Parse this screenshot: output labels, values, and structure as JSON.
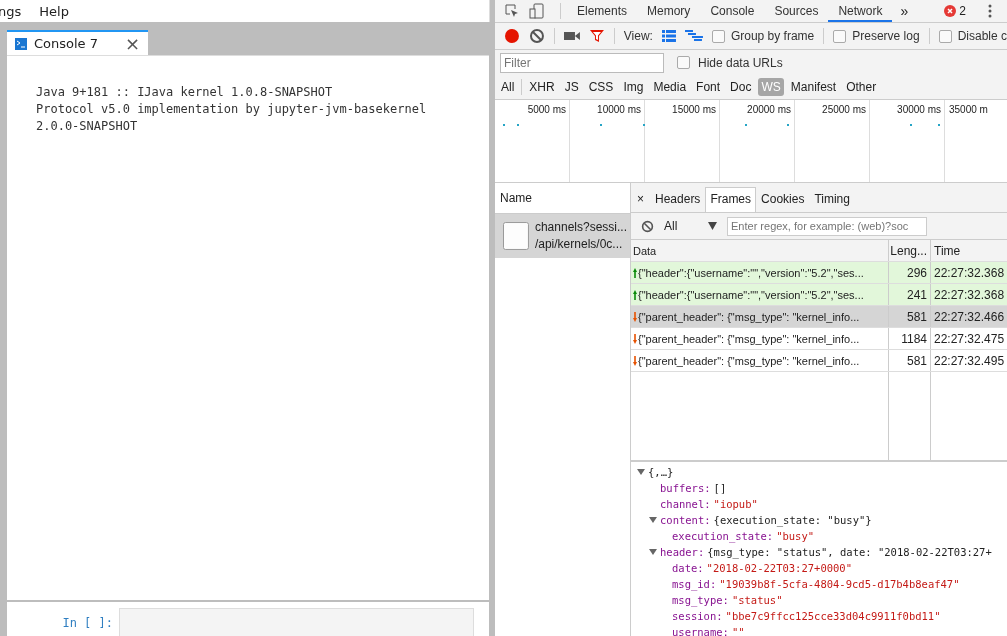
{
  "menu_bar": {
    "items": [
      "ngs",
      "Help"
    ]
  },
  "console_tab": {
    "label": "Console 7",
    "close": "×"
  },
  "console_output": [
    "Java 9+181 :: IJava kernel 1.0.8-SNAPSHOT",
    "Protocol v5.0 implementation by jupyter-jvm-basekernel",
    "2.0.0-SNAPSHOT"
  ],
  "prompt": {
    "label": "In [ ]:"
  },
  "devtools": {
    "tabs": [
      {
        "label": "Elements",
        "selected": false
      },
      {
        "label": "Memory",
        "selected": false
      },
      {
        "label": "Console",
        "selected": false
      },
      {
        "label": "Sources",
        "selected": false
      },
      {
        "label": "Network",
        "selected": true
      }
    ],
    "more": "»",
    "error_count": "2",
    "toolbar": {
      "recording": true,
      "view_label": "View:",
      "checkboxes": [
        {
          "label": "Group by frame",
          "checked": false
        },
        {
          "label": "Preserve log",
          "checked": false
        },
        {
          "label": "Disable c",
          "checked": false
        }
      ]
    },
    "filter": {
      "placeholder": "Filter",
      "hide_data_urls": {
        "label": "Hide data URLs",
        "checked": false
      }
    },
    "types": [
      {
        "label": "All",
        "selected": false
      },
      {
        "label": "XHR",
        "selected": false
      },
      {
        "label": "JS",
        "selected": false
      },
      {
        "label": "CSS",
        "selected": false
      },
      {
        "label": "Img",
        "selected": false
      },
      {
        "label": "Media",
        "selected": false
      },
      {
        "label": "Font",
        "selected": false
      },
      {
        "label": "Doc",
        "selected": false
      },
      {
        "label": "WS",
        "selected": true
      },
      {
        "label": "Manifest",
        "selected": false
      },
      {
        "label": "Other",
        "selected": false
      }
    ],
    "timeline_ticks": [
      "5000 ms",
      "10000 ms",
      "15000 ms",
      "20000 ms",
      "25000 ms",
      "30000 ms",
      "35000 m"
    ],
    "name_header": "Name",
    "requests": [
      {
        "name": "channels?sessi...",
        "path": "/api/kernels/0c...",
        "selected": true
      }
    ],
    "detail_tabs": [
      {
        "label": "Headers",
        "selected": false
      },
      {
        "label": "Frames",
        "selected": true
      },
      {
        "label": "Cookies",
        "selected": false
      },
      {
        "label": "Timing",
        "selected": false
      }
    ],
    "detail_close": "×",
    "frame_filter": {
      "type": "All",
      "placeholder": "Enter regex, for example: (web)?soc"
    },
    "frames": {
      "columns": [
        "Data",
        "Leng...",
        "Time"
      ],
      "rows": [
        {
          "kind": "sent",
          "data": "{\"header\":{\"username\":\"\",\"version\":\"5.2\",\"ses...",
          "length": "296",
          "time": "22:27:32.368",
          "selected": false
        },
        {
          "kind": "sent",
          "data": "{\"header\":{\"username\":\"\",\"version\":\"5.2\",\"ses...",
          "length": "241",
          "time": "22:27:32.368",
          "selected": false
        },
        {
          "kind": "received",
          "data": "{\"parent_header\": {\"msg_type\": \"kernel_info...",
          "length": "581",
          "time": "22:27:32.466",
          "selected": true
        },
        {
          "kind": "received",
          "data": "{\"parent_header\": {\"msg_type\": \"kernel_info...",
          "length": "1184",
          "time": "22:27:32.475",
          "selected": false
        },
        {
          "kind": "received",
          "data": "{\"parent_header\": {\"msg_type\": \"kernel_info...",
          "length": "581",
          "time": "22:27:32.495",
          "selected": false
        }
      ]
    },
    "message_tree": [
      {
        "value": "{,…}",
        "kind": "object",
        "expanded": true,
        "children": [
          {
            "key": "buffers:",
            "value": "[]",
            "kind": "object"
          },
          {
            "key": "channel:",
            "value": "\"iopub\"",
            "kind": "string"
          },
          {
            "key": "content:",
            "value": "{execution_state: \"busy\"}",
            "kind": "object",
            "expanded": true,
            "children": [
              {
                "key": "execution_state:",
                "value": "\"busy\"",
                "kind": "string"
              }
            ]
          },
          {
            "key": "header:",
            "value": "{msg_type: \"status\", date: \"2018-02-22T03:27+",
            "kind": "object",
            "expanded": true,
            "children": [
              {
                "key": "date:",
                "value": "\"2018-02-22T03:27+0000\"",
                "kind": "string"
              },
              {
                "key": "msg_id:",
                "value": "\"19039b8f-5cfa-4804-9cd5-d17b4b8eaf47\"",
                "kind": "string"
              },
              {
                "key": "msg_type:",
                "value": "\"status\"",
                "kind": "string"
              },
              {
                "key": "session:",
                "value": "\"bbe7c9ffcc125cce33d04c9911f0bd11\"",
                "kind": "string"
              },
              {
                "key": "username:",
                "value": "\"\"",
                "kind": "string"
              }
            ]
          }
        ]
      }
    ]
  }
}
